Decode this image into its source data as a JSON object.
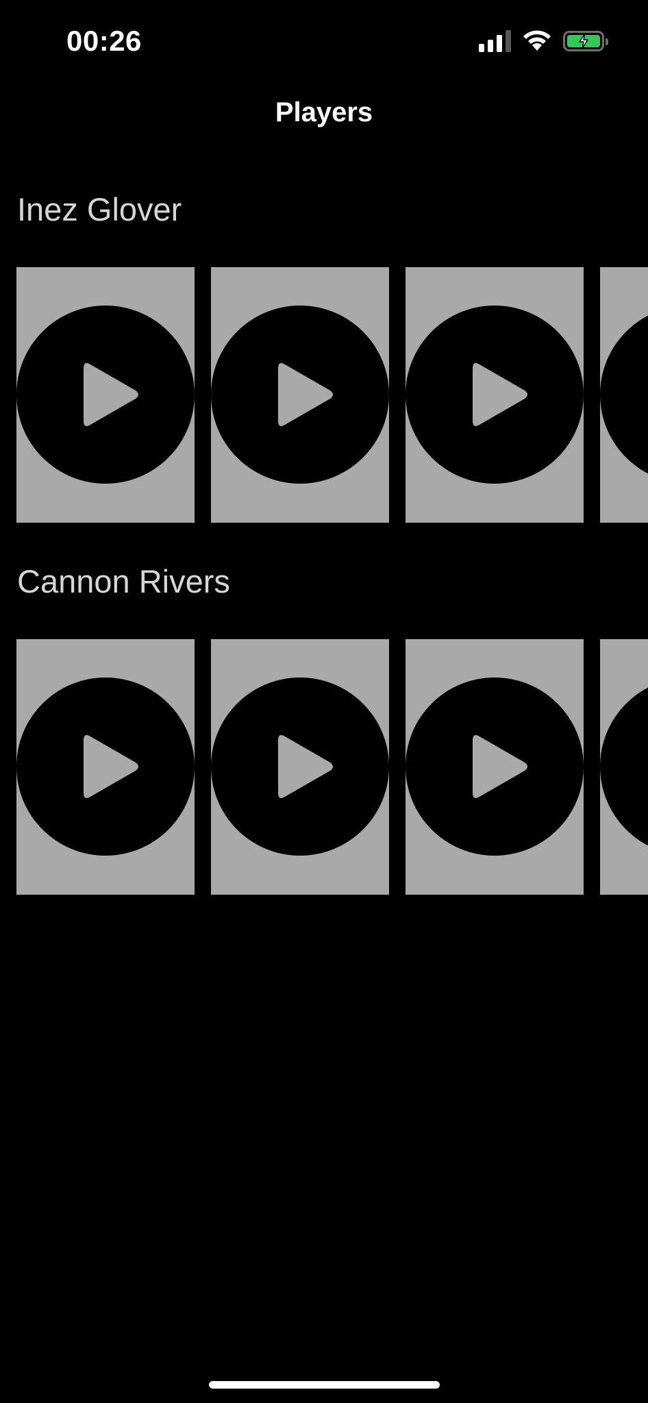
{
  "status_bar": {
    "time": "00:26",
    "signal_icon": "cellular-signal-icon",
    "wifi_icon": "wifi-icon",
    "battery_icon": "battery-charging-icon",
    "battery_color": "#34c759"
  },
  "nav": {
    "title": "Players"
  },
  "sections": [
    {
      "title": "Inez Glover",
      "tiles": [
        {
          "icon": "play-icon"
        },
        {
          "icon": "play-icon"
        },
        {
          "icon": "play-icon"
        },
        {
          "icon": "play-icon"
        }
      ]
    },
    {
      "title": "Cannon Rivers",
      "tiles": [
        {
          "icon": "play-icon"
        },
        {
          "icon": "play-icon"
        },
        {
          "icon": "play-icon"
        },
        {
          "icon": "play-icon"
        }
      ]
    }
  ],
  "colors": {
    "background": "#000000",
    "tile": "#a9a9a9",
    "section_title": "#d6d6d6"
  }
}
